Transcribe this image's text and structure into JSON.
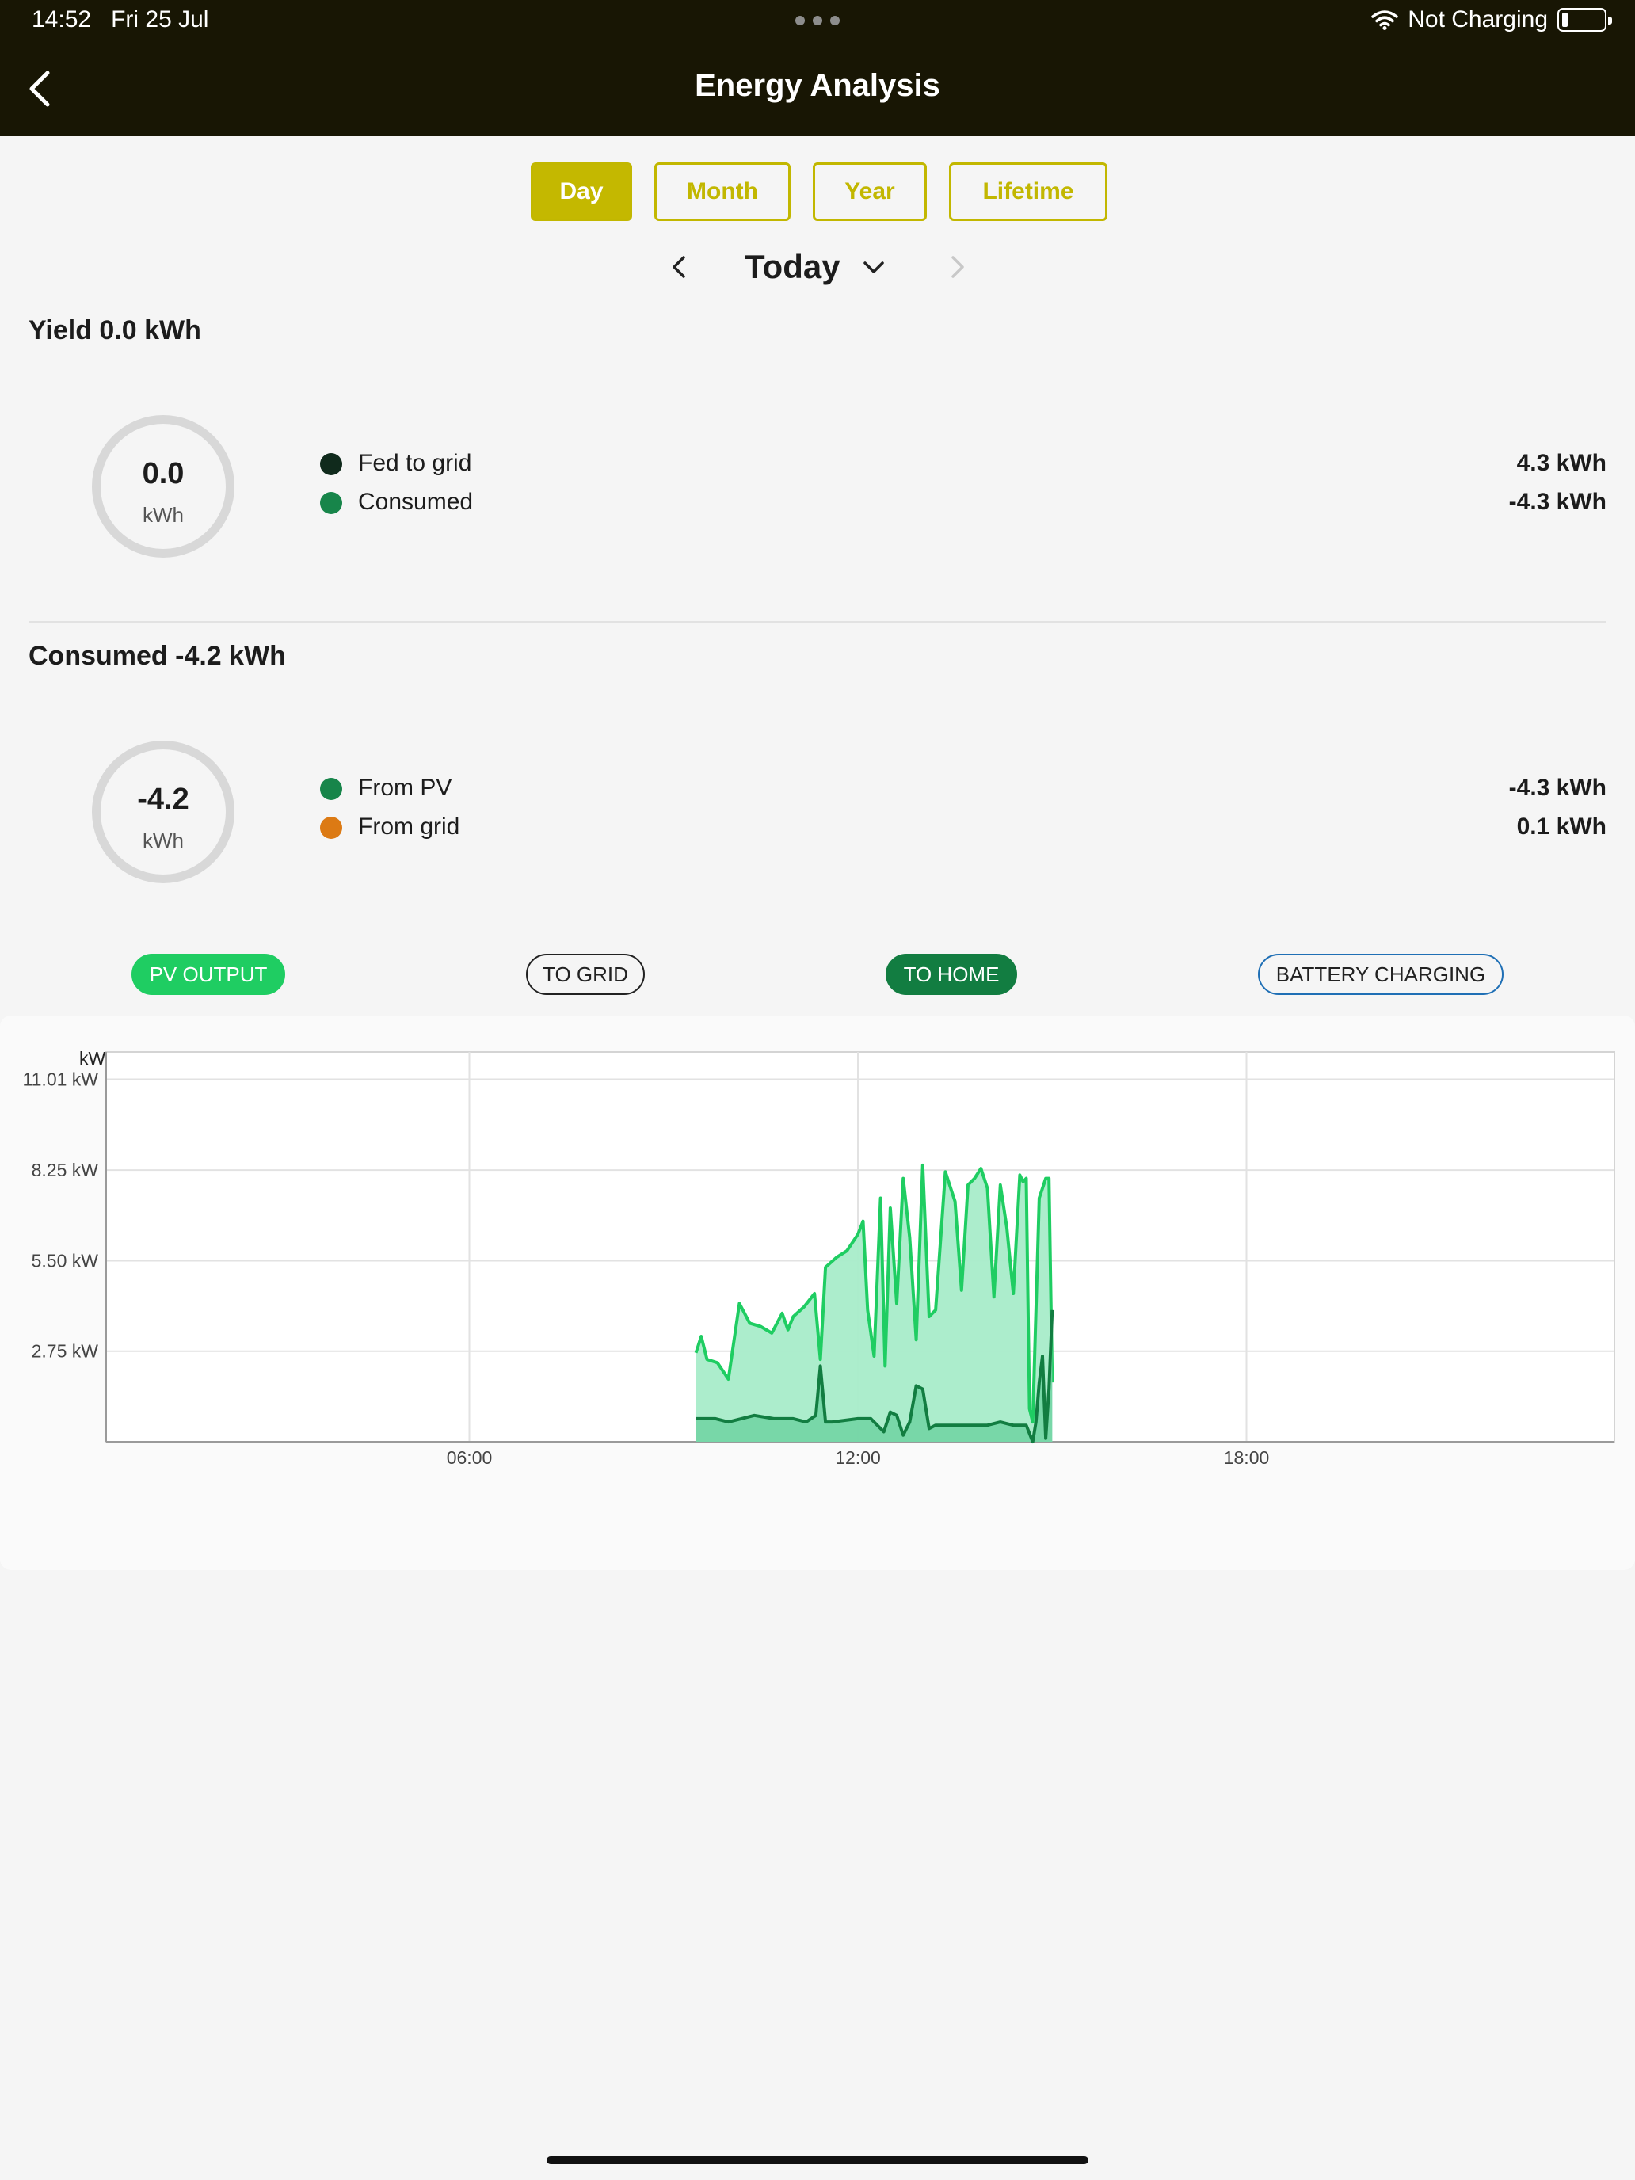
{
  "status_bar": {
    "time": "14:52",
    "date": "Fri 25 Jul",
    "charging": "Not Charging"
  },
  "header": {
    "title": "Energy Analysis"
  },
  "period_tabs": [
    {
      "label": "Day",
      "active": true
    },
    {
      "label": "Month",
      "active": false
    },
    {
      "label": "Year",
      "active": false
    },
    {
      "label": "Lifetime",
      "active": false
    }
  ],
  "date_nav": {
    "label": "Today"
  },
  "yield": {
    "title": "Yield 0.0 kWh",
    "ring_value": "0.0",
    "ring_unit": "kWh",
    "rows": [
      {
        "label": "Fed to grid",
        "value": "4.3 kWh",
        "color": "#102a1c"
      },
      {
        "label": "Consumed",
        "value": "-4.3 kWh",
        "color": "#17854a"
      }
    ]
  },
  "consumed": {
    "title": "Consumed -4.2 kWh",
    "ring_value": "-4.2",
    "ring_unit": "kWh",
    "rows": [
      {
        "label": "From PV",
        "value": "-4.3 kWh",
        "color": "#17854a"
      },
      {
        "label": "From grid",
        "value": "0.1 kWh",
        "color": "#dc7a14"
      }
    ]
  },
  "series_pills": [
    {
      "label": "PV OUTPUT",
      "bg": "#1fcd62",
      "fg": "#ffffff",
      "border": "#1fcd62"
    },
    {
      "label": "TO GRID",
      "bg": "transparent",
      "fg": "#222222",
      "border": "#222222"
    },
    {
      "label": "TO HOME",
      "bg": "#127d41",
      "fg": "#ffffff",
      "border": "#127d41"
    },
    {
      "label": "BATTERY CHARGING",
      "bg": "transparent",
      "fg": "#222222",
      "border": "#1f6fb5"
    }
  ],
  "chart_data": {
    "type": "area",
    "unit": "kW",
    "ylim": [
      0,
      11.84
    ],
    "y_ticks": [
      {
        "value": 11.01,
        "label": "11.01 kW"
      },
      {
        "value": 8.25,
        "label": "8.25 kW"
      },
      {
        "value": 5.5,
        "label": "5.50 kW"
      },
      {
        "value": 2.75,
        "label": "2.75 kW"
      }
    ],
    "xlim": [
      0,
      24
    ],
    "x_ticks": [
      {
        "value": 6,
        "label": "06:00"
      },
      {
        "value": 12,
        "label": "12:00"
      },
      {
        "value": 18,
        "label": "18:00"
      }
    ],
    "grid": true,
    "series": [
      {
        "name": "PV OUTPUT",
        "color": "#1fcd62",
        "fill": "#a8ecc9",
        "x": [
          9.5,
          9.58,
          9.67,
          9.83,
          10.0,
          10.17,
          10.33,
          10.5,
          10.67,
          10.83,
          10.92,
          11.0,
          11.17,
          11.33,
          11.42,
          11.5,
          11.67,
          11.83,
          12.0,
          12.08,
          12.15,
          12.25,
          12.35,
          12.42,
          12.5,
          12.6,
          12.7,
          12.8,
          12.9,
          13.0,
          13.1,
          13.2,
          13.35,
          13.5,
          13.6,
          13.7,
          13.8,
          13.9,
          14.0,
          14.1,
          14.2,
          14.3,
          14.4,
          14.5,
          14.55,
          14.6,
          14.65,
          14.7,
          14.8,
          14.9,
          14.95,
          15.0
        ],
        "y": [
          2.7,
          3.2,
          2.5,
          2.4,
          1.9,
          4.2,
          3.6,
          3.5,
          3.3,
          3.9,
          3.4,
          3.8,
          4.1,
          4.5,
          2.5,
          5.3,
          5.6,
          5.8,
          6.3,
          6.7,
          4.0,
          2.6,
          7.4,
          2.3,
          7.1,
          4.2,
          8.0,
          6.2,
          3.1,
          8.4,
          3.8,
          4.0,
          8.2,
          7.3,
          4.6,
          7.8,
          8.0,
          8.3,
          7.7,
          4.4,
          7.8,
          6.5,
          4.5,
          8.1,
          7.9,
          8.0,
          1.0,
          0.6,
          7.4,
          8.0,
          8.0,
          1.8
        ]
      },
      {
        "name": "TO HOME",
        "color": "#127d41",
        "fill": "#72d4a4",
        "x": [
          9.5,
          9.8,
          10.0,
          10.2,
          10.4,
          10.7,
          11.0,
          11.2,
          11.35,
          11.42,
          11.5,
          11.6,
          12.0,
          12.2,
          12.4,
          12.5,
          12.6,
          12.7,
          12.8,
          12.9,
          13.0,
          13.1,
          13.2,
          13.4,
          13.6,
          13.8,
          14.0,
          14.2,
          14.4,
          14.5,
          14.6,
          14.7,
          14.75,
          14.8,
          14.85,
          14.9,
          14.95,
          15.0
        ],
        "y": [
          0.7,
          0.7,
          0.6,
          0.7,
          0.8,
          0.7,
          0.7,
          0.6,
          0.8,
          2.3,
          0.6,
          0.6,
          0.7,
          0.7,
          0.3,
          0.9,
          0.8,
          0.2,
          0.6,
          1.7,
          1.6,
          0.4,
          0.5,
          0.5,
          0.5,
          0.5,
          0.5,
          0.6,
          0.5,
          0.5,
          0.5,
          0.0,
          0.6,
          1.8,
          2.6,
          0.1,
          1.6,
          4.0
        ]
      }
    ]
  }
}
